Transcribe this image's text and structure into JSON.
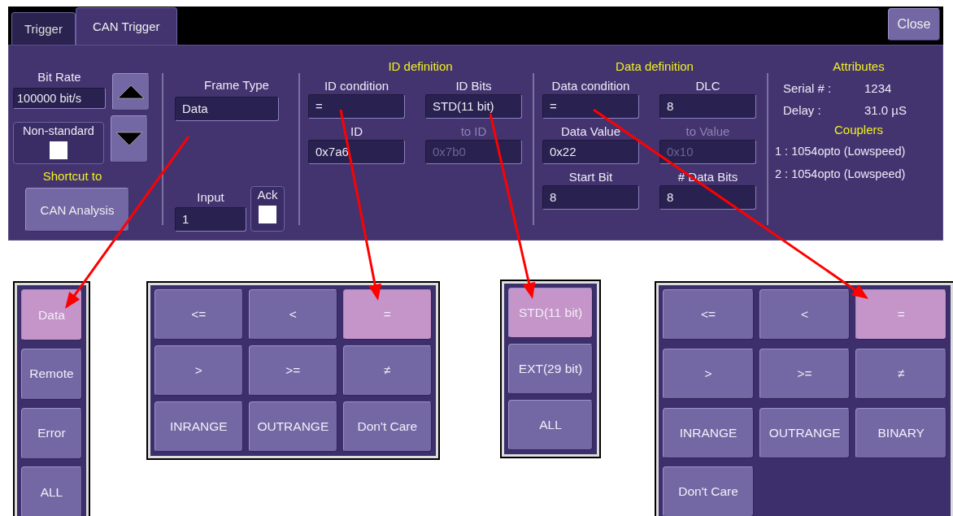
{
  "tabs": [
    {
      "label": "Trigger",
      "selected": false
    },
    {
      "label": "CAN Trigger",
      "selected": true
    }
  ],
  "close_button": "Close",
  "bit_rate": {
    "label": "Bit Rate",
    "value": "100000 bit/s"
  },
  "non_standard": {
    "label": "Non-standard",
    "checked": false
  },
  "shortcut": {
    "label": "Shortcut to",
    "button": "CAN Analysis"
  },
  "frame_type": {
    "label": "Frame Type",
    "value": "Data"
  },
  "input": {
    "label": "Input",
    "value": "1"
  },
  "ack": {
    "label": "Ack",
    "checked": false
  },
  "id_definition": {
    "title": "ID definition",
    "fields": [
      {
        "label": "ID condition",
        "value": "=",
        "disabled": false
      },
      {
        "label": "ID Bits",
        "value": "STD(11 bit)",
        "disabled": false
      },
      {
        "label": "ID",
        "value": "0x7a6",
        "disabled": false
      },
      {
        "label": "to ID",
        "value": "0x7b0",
        "disabled": true
      }
    ]
  },
  "data_definition": {
    "title": "Data definition",
    "fields": [
      {
        "label": "Data condition",
        "value": "=",
        "disabled": false
      },
      {
        "label": "DLC",
        "value": "8",
        "disabled": false
      },
      {
        "label": "Data Value",
        "value": "0x22",
        "disabled": false
      },
      {
        "label": "to Value",
        "value": "0x10",
        "disabled": true
      },
      {
        "label": "Start Bit",
        "value": "8",
        "disabled": false
      },
      {
        "label": "# Data Bits",
        "value": "8",
        "disabled": false
      }
    ]
  },
  "attributes": {
    "title": "Attributes",
    "rows": [
      {
        "label": "Serial # :",
        "value": "1234"
      },
      {
        "label": "Delay :",
        "value": "31.0 µS"
      }
    ],
    "couplers_title": "Couplers",
    "couplers": [
      "1 : 1054opto (Lowspeed)",
      "2 : 1054opto (Lowspeed)"
    ]
  },
  "popups": [
    {
      "kind": "list",
      "options": [
        {
          "label": "Data",
          "selected": true
        },
        {
          "label": "Remote",
          "selected": false
        },
        {
          "label": "Error",
          "selected": false
        },
        {
          "label": "ALL",
          "selected": false
        }
      ]
    },
    {
      "kind": "grid",
      "options": [
        {
          "label": "<=",
          "selected": false
        },
        {
          "label": "<",
          "selected": false
        },
        {
          "label": "=",
          "selected": true
        },
        {
          "label": ">",
          "selected": false
        },
        {
          "label": ">=",
          "selected": false
        },
        {
          "label": "≠",
          "selected": false
        },
        {
          "label": "INRANGE",
          "selected": false
        },
        {
          "label": "OUTRANGE",
          "selected": false
        },
        {
          "label": "Don't Care",
          "selected": false
        }
      ]
    },
    {
      "kind": "list",
      "options": [
        {
          "label": "STD(11 bit)",
          "selected": true
        },
        {
          "label": "EXT(29 bit)",
          "selected": false
        },
        {
          "label": "ALL",
          "selected": false
        }
      ]
    },
    {
      "kind": "grid",
      "options": [
        {
          "label": "<=",
          "selected": false
        },
        {
          "label": "<",
          "selected": false
        },
        {
          "label": "=",
          "selected": true
        },
        {
          "label": ">",
          "selected": false
        },
        {
          "label": ">=",
          "selected": false
        },
        {
          "label": "≠",
          "selected": false
        },
        {
          "label": "INRANGE",
          "selected": false
        },
        {
          "label": "OUTRANGE",
          "selected": false
        },
        {
          "label": "BINARY",
          "selected": false
        },
        {
          "label": "Don't Care",
          "selected": false
        }
      ]
    }
  ]
}
